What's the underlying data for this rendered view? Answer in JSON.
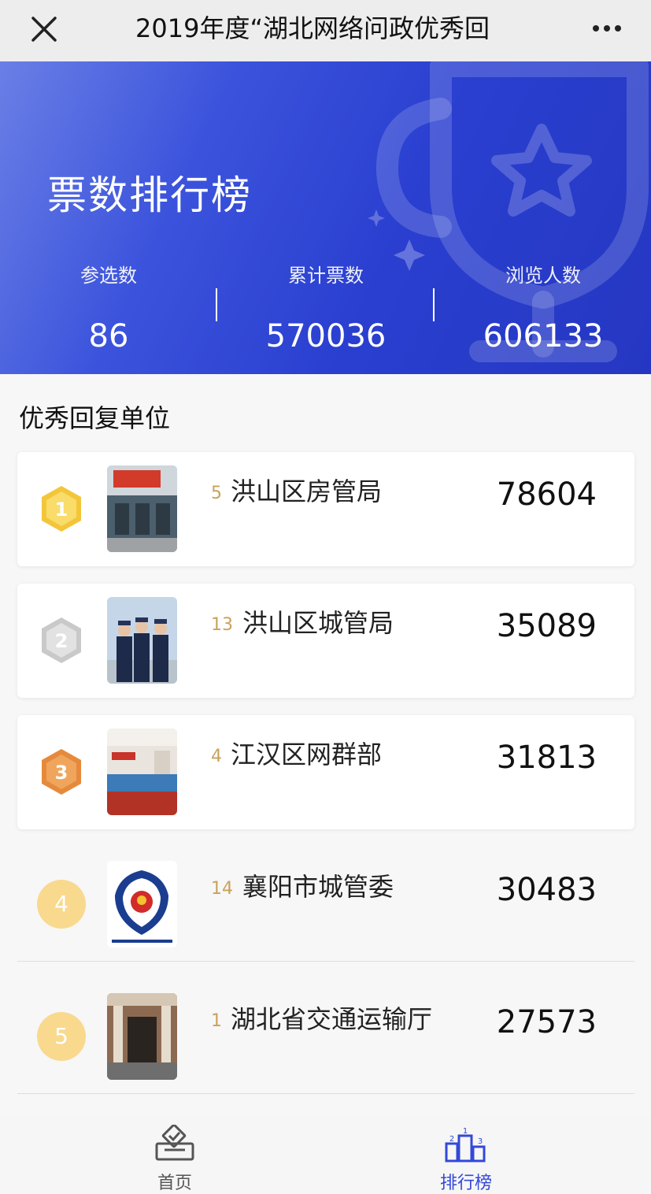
{
  "topbar": {
    "title": "2019年度“湖北网络问政优秀回",
    "close_icon": "close-icon",
    "more_icon": "more-icon"
  },
  "hero": {
    "title": "票数排行榜",
    "stats": [
      {
        "label": "参选数",
        "value": "86"
      },
      {
        "label": "累计票数",
        "value": "570036"
      },
      {
        "label": "浏览人数",
        "value": "606133"
      }
    ]
  },
  "section": {
    "title": "优秀回复单位"
  },
  "rows": [
    {
      "rank": "1",
      "no": "5",
      "name": "洪山区房管局",
      "votes": "78604",
      "medal": "gold"
    },
    {
      "rank": "2",
      "no": "13",
      "name": "洪山区城管局",
      "votes": "35089",
      "medal": "silver"
    },
    {
      "rank": "3",
      "no": "4",
      "name": "江汉区网群部",
      "votes": "31813",
      "medal": "bronze"
    },
    {
      "rank": "4",
      "no": "14",
      "name": "襄阳市城管委",
      "votes": "30483"
    },
    {
      "rank": "5",
      "no": "1",
      "name": "湖北省交通运输厅",
      "votes": "27573"
    }
  ],
  "nav": {
    "home_label": "首页",
    "rank_label": "排行榜"
  },
  "colors": {
    "accent": "#2a3fd0",
    "gold_medal": "#f3c63a",
    "silver_medal": "#c9c9c9",
    "bronze_medal": "#e58a3c",
    "rank_circle": "#f8d98e",
    "number_tint": "#c9a25a",
    "nav_active": "#3348d8",
    "nav_inactive": "#555555"
  }
}
